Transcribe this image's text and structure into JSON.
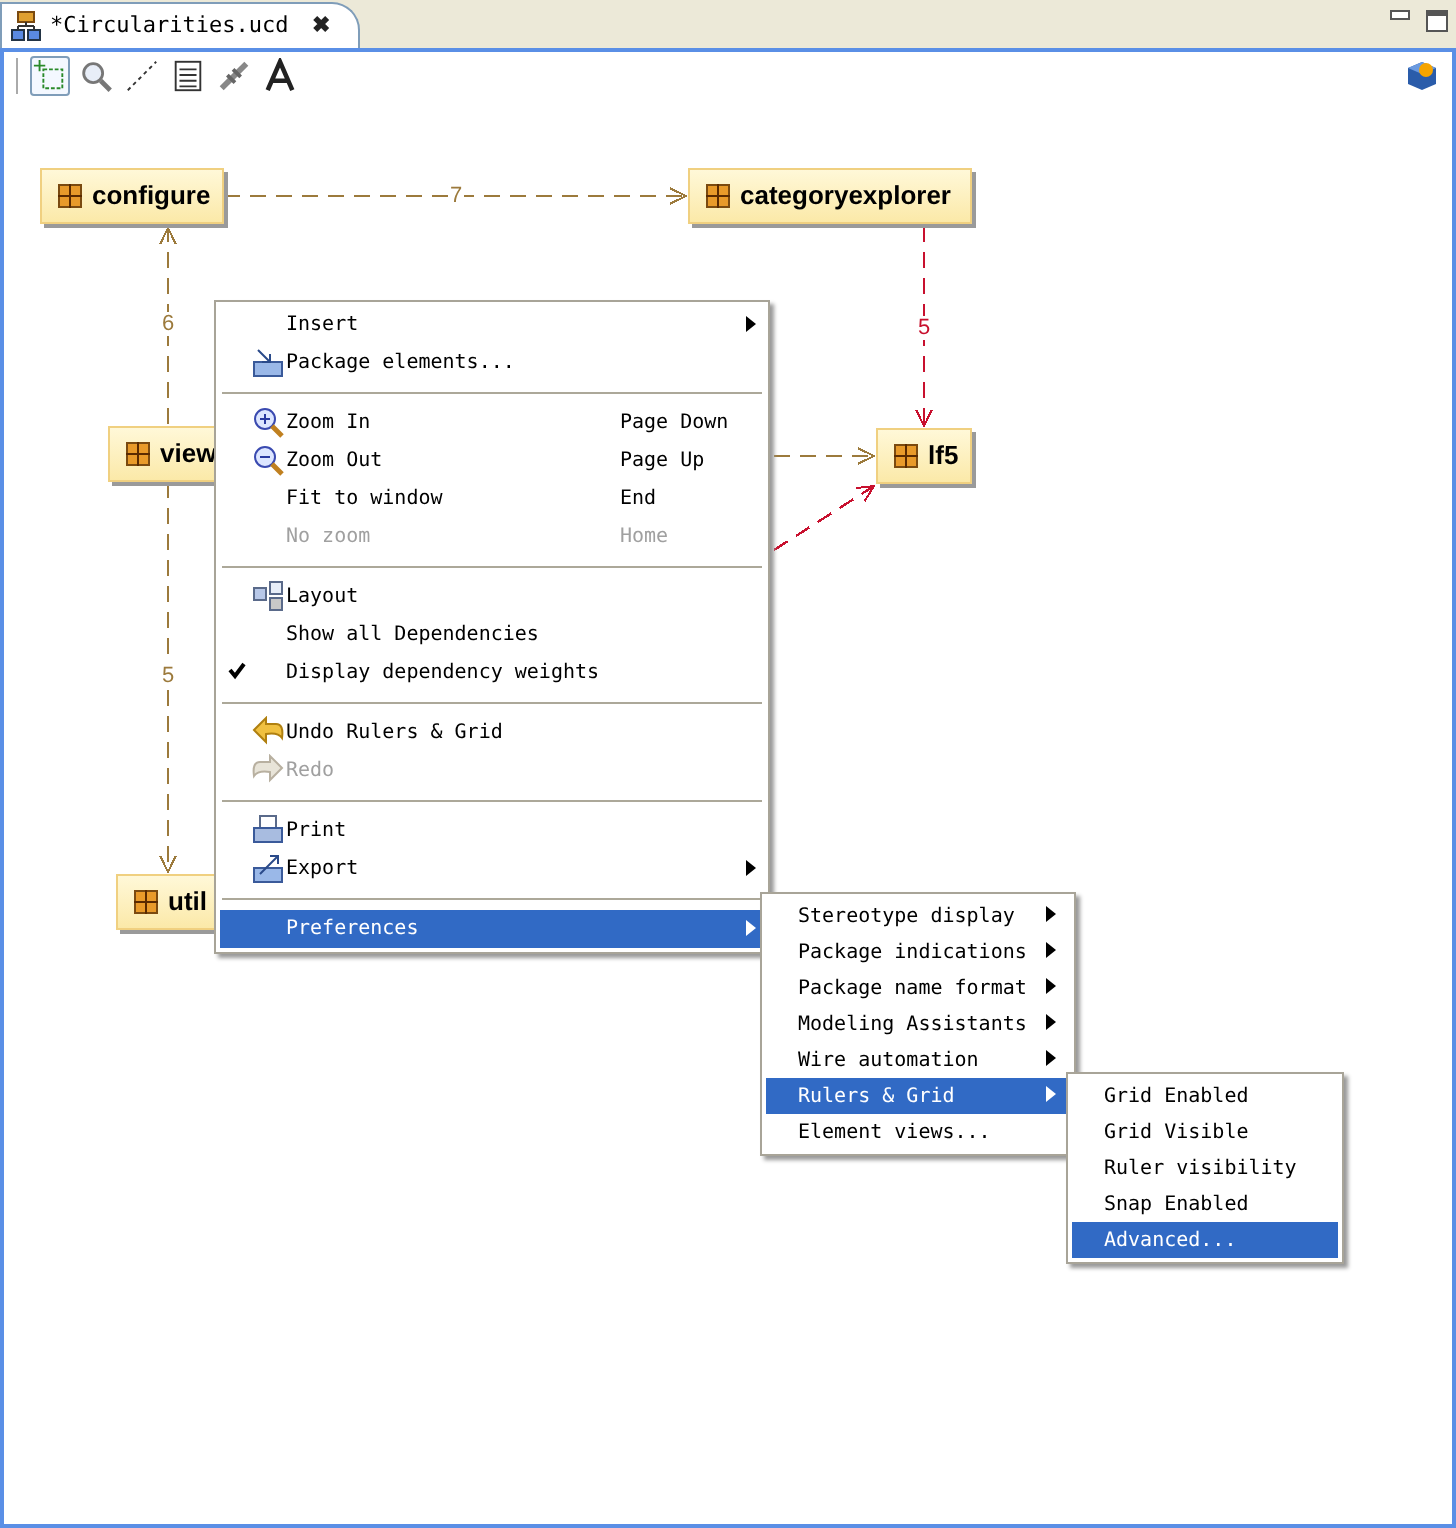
{
  "tab": {
    "title": "*Circularities.ucd",
    "close": "✖"
  },
  "toolbar": {
    "tools": [
      {
        "kind": "select",
        "selected": true
      },
      {
        "kind": "zoom",
        "selected": false
      },
      {
        "kind": "dependency",
        "selected": false
      },
      {
        "kind": "note",
        "selected": false
      },
      {
        "kind": "link",
        "selected": false
      },
      {
        "kind": "text",
        "selected": false
      }
    ]
  },
  "diagram": {
    "packages": [
      {
        "name": "configure"
      },
      {
        "name": "categoryexplorer"
      },
      {
        "name": "view"
      },
      {
        "name": "lf5"
      },
      {
        "name": "util"
      }
    ],
    "dependencies": [
      {
        "weight": "7",
        "color": "#9c7a3c"
      },
      {
        "weight": "6",
        "color": "#9c7a3c"
      },
      {
        "weight": "5",
        "color": "#9c7a3c"
      },
      {
        "weight": "5",
        "color": "#c8102e"
      },
      {
        "color": "#9c7a3c"
      },
      {
        "color": "#c8102e"
      }
    ]
  },
  "context_menu": {
    "groups": [
      [
        {
          "label": "Insert",
          "submenu": true,
          "disabled": false,
          "checked": false,
          "selected": false
        },
        {
          "label": "Package elements...",
          "kind": "package",
          "submenu": false,
          "disabled": false,
          "checked": false,
          "selected": false
        }
      ],
      [
        {
          "label": "Zoom In",
          "shortcut": "Page Down",
          "kind": "zoom-in",
          "submenu": false,
          "disabled": false,
          "checked": false,
          "selected": false
        },
        {
          "label": "Zoom Out",
          "shortcut": "Page Up",
          "kind": "zoom-out",
          "submenu": false,
          "disabled": false,
          "checked": false,
          "selected": false
        },
        {
          "label": "Fit to window",
          "shortcut": "End",
          "submenu": false,
          "disabled": false,
          "checked": false,
          "selected": false
        },
        {
          "label": "No zoom",
          "shortcut": "Home",
          "submenu": false,
          "disabled": true,
          "checked": false,
          "selected": false
        }
      ],
      [
        {
          "label": "Layout",
          "kind": "layout",
          "submenu": false,
          "disabled": false,
          "checked": false,
          "selected": false
        },
        {
          "label": "Show all Dependencies",
          "submenu": false,
          "disabled": false,
          "checked": false,
          "selected": false
        },
        {
          "label": "Display dependency weights",
          "submenu": false,
          "disabled": false,
          "checked": true,
          "selected": false
        }
      ],
      [
        {
          "label": "Undo Rulers & Grid",
          "kind": "undo",
          "submenu": false,
          "disabled": false,
          "checked": false,
          "selected": false
        },
        {
          "label": "Redo",
          "kind": "redo",
          "submenu": false,
          "disabled": true,
          "checked": false,
          "selected": false
        }
      ],
      [
        {
          "label": "Print",
          "kind": "print",
          "submenu": false,
          "disabled": false,
          "checked": false,
          "selected": false
        },
        {
          "label": "Export",
          "kind": "export",
          "submenu": true,
          "disabled": false,
          "checked": false,
          "selected": false
        }
      ],
      [
        {
          "label": "Preferences",
          "submenu": true,
          "disabled": false,
          "checked": false,
          "selected": true
        }
      ]
    ]
  },
  "preferences_menu": {
    "items": [
      {
        "label": "Stereotype display",
        "submenu": true,
        "selected": false
      },
      {
        "label": "Package indications",
        "submenu": true,
        "selected": false
      },
      {
        "label": "Package name format",
        "submenu": true,
        "selected": false
      },
      {
        "label": "Modeling Assistants",
        "submenu": true,
        "selected": false
      },
      {
        "label": "Wire automation",
        "submenu": true,
        "selected": false
      },
      {
        "label": "Rulers & Grid",
        "submenu": true,
        "selected": true
      },
      {
        "label": "Element views...",
        "submenu": false,
        "selected": false
      }
    ]
  },
  "rulers_grid_menu": {
    "items": [
      {
        "label": "Grid Enabled",
        "selected": false
      },
      {
        "label": "Grid Visible",
        "selected": false
      },
      {
        "label": "Ruler visibility",
        "selected": false
      },
      {
        "label": "Snap Enabled",
        "selected": false
      },
      {
        "label": "Advanced...",
        "selected": true
      }
    ]
  }
}
